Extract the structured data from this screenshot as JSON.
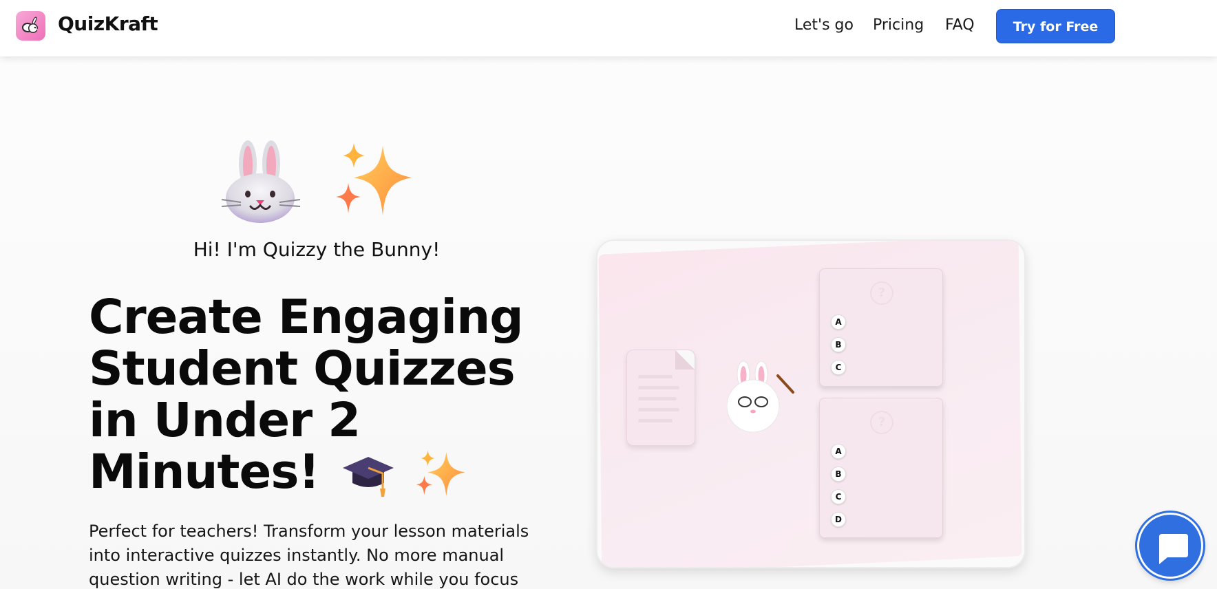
{
  "brand": {
    "name": "QuizKraft",
    "logo_icon": "rabbit-icon",
    "logo_color": "#ef6fb8"
  },
  "nav": {
    "items": [
      "Let's go",
      "Pricing",
      "FAQ"
    ],
    "cta_label": "Try for Free",
    "cta_color": "#2a6ae6"
  },
  "hero": {
    "mascot_icons": [
      "rabbit-face-icon",
      "sparkles-icon"
    ],
    "greeting": "Hi! I'm Quizzy the Bunny!",
    "headline_lines": [
      "Create Engaging",
      "Student Quizzes",
      "in Under 2",
      "Minutes!"
    ],
    "headline_icons": [
      "graduation-cap-icon",
      "sparkles-icon"
    ],
    "description": "Perfect for teachers! Transform your lesson materials into interactive quizzes instantly. No more manual question writing - let AI do the work while you focus"
  },
  "illustration": {
    "quiz1": {
      "mark": "?",
      "options": [
        "A",
        "B",
        "C"
      ]
    },
    "quiz2": {
      "mark": "?",
      "options": [
        "A",
        "B",
        "C",
        "D"
      ]
    }
  },
  "chat": {
    "icon": "chat-bubble-icon",
    "color": "#2f6fe0"
  }
}
